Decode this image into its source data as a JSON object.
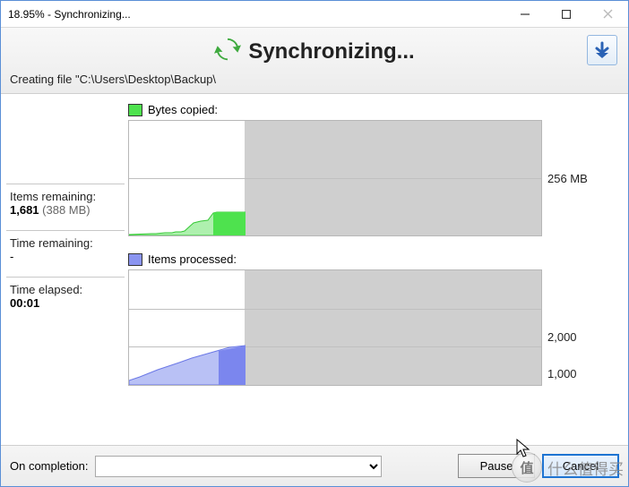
{
  "window": {
    "title": "18.95% - Synchronizing..."
  },
  "header": {
    "title": "Synchronizing...",
    "status_prefix": "Creating file ",
    "status_path": "\"C:\\Users\\Desktop\\Backup\\"
  },
  "stats": {
    "items_remaining_label": "Items remaining:",
    "items_remaining_value": "1,681",
    "items_remaining_size": "(388 MB)",
    "time_remaining_label": "Time remaining:",
    "time_remaining_value": "-",
    "time_elapsed_label": "Time elapsed:",
    "time_elapsed_value": "00:01"
  },
  "charts": {
    "bytes": {
      "legend": "Bytes copied:",
      "ylabels": [
        "256 MB"
      ]
    },
    "items": {
      "legend": "Items processed:",
      "ylabels": [
        "2,000",
        "1,000"
      ]
    }
  },
  "bottom": {
    "completion_label": "On completion:",
    "completion_value": "",
    "pause": "Pause",
    "cancel": "Cancel"
  },
  "progress_percent": 28,
  "watermark": {
    "circle": "值",
    "text": "什么值得买"
  },
  "chart_data": [
    {
      "type": "area",
      "title": "Bytes copied:",
      "ylabel": "MB",
      "ylim": [
        0,
        256
      ],
      "series": [
        {
          "name": "Bytes copied",
          "x": [
            0,
            2,
            3,
            4,
            5,
            6,
            6.5,
            7,
            7.5,
            8,
            8.2,
            9,
            10
          ],
          "values": [
            0,
            2,
            2,
            4,
            4,
            6,
            28,
            32,
            34,
            50,
            52,
            52,
            52
          ]
        }
      ],
      "progress_fraction": 0.28,
      "color": "#4ee24e"
    },
    {
      "type": "area",
      "title": "Items processed:",
      "ylabel": "items",
      "ylim": [
        0,
        3000
      ],
      "series": [
        {
          "name": "Items processed",
          "x": [
            0,
            1,
            2,
            3,
            4,
            5,
            6,
            7,
            8,
            9,
            10
          ],
          "values": [
            100,
            200,
            320,
            420,
            520,
            620,
            720,
            830,
            930,
            1020,
            1020
          ]
        }
      ],
      "gridlines_y": [
        1000,
        2000
      ],
      "progress_fraction": 0.28,
      "color": "#8a94f0"
    }
  ]
}
